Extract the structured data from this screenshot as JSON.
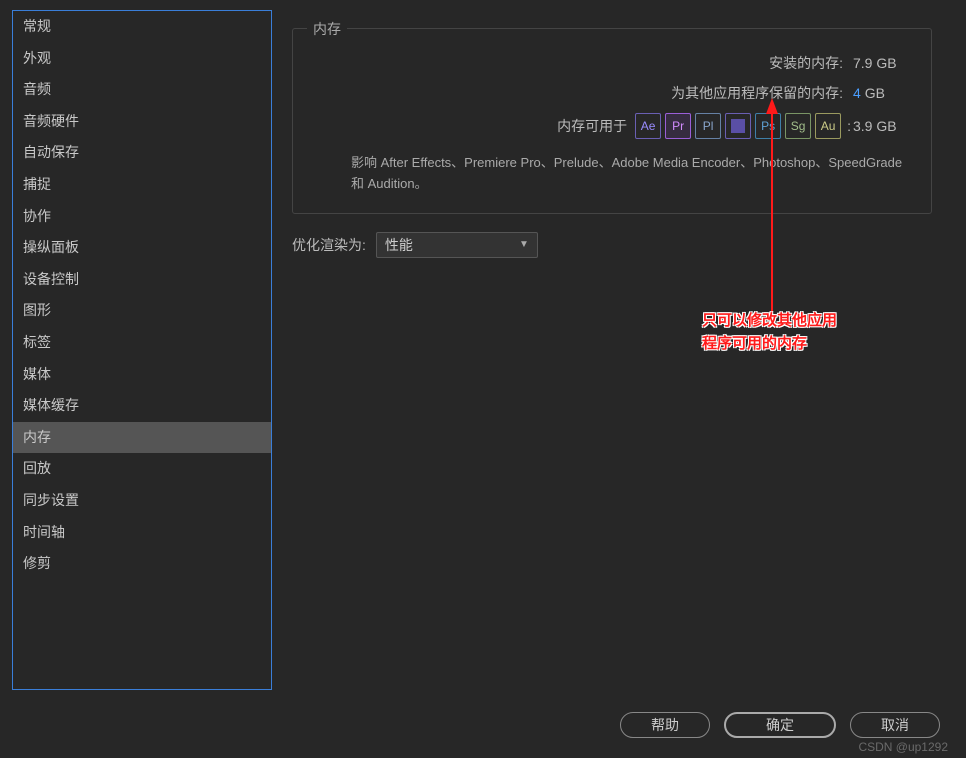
{
  "sidebar": {
    "items": [
      {
        "label": "常规"
      },
      {
        "label": "外观"
      },
      {
        "label": "音频"
      },
      {
        "label": "音频硬件"
      },
      {
        "label": "自动保存"
      },
      {
        "label": "捕捉"
      },
      {
        "label": "协作"
      },
      {
        "label": "操纵面板"
      },
      {
        "label": "设备控制"
      },
      {
        "label": "图形"
      },
      {
        "label": "标签"
      },
      {
        "label": "媒体"
      },
      {
        "label": "媒体缓存"
      },
      {
        "label": "内存",
        "selected": true
      },
      {
        "label": "回放"
      },
      {
        "label": "同步设置"
      },
      {
        "label": "时间轴"
      },
      {
        "label": "修剪"
      }
    ]
  },
  "memory": {
    "panel_title": "内存",
    "installed_label": "安装的内存:",
    "installed_value": "7.9 GB",
    "reserved_label": "为其他应用程序保留的内存:",
    "reserved_value": "4",
    "reserved_unit": "GB",
    "available_label": "内存可用于",
    "available_value": "3.9 GB",
    "apps": [
      {
        "code": "Ae",
        "cls": "ae"
      },
      {
        "code": "Pr",
        "cls": "pr"
      },
      {
        "code": "Pl",
        "cls": "pl"
      },
      {
        "code": "",
        "cls": "me",
        "special": "block"
      },
      {
        "code": "Ps",
        "cls": "ps"
      },
      {
        "code": "Sg",
        "cls": "sg"
      },
      {
        "code": "Au",
        "cls": "au"
      }
    ],
    "description": "影响 After Effects、Premiere Pro、Prelude、Adobe Media Encoder、Photoshop、SpeedGrade 和 Audition。"
  },
  "render": {
    "label": "优化渲染为:",
    "selected": "性能"
  },
  "annotation": {
    "line1": "只可以修改其他应用",
    "line2": "程序可用的内存"
  },
  "buttons": {
    "help": "帮助",
    "ok": "确定",
    "cancel": "取消"
  },
  "watermark": "CSDN @up1292"
}
